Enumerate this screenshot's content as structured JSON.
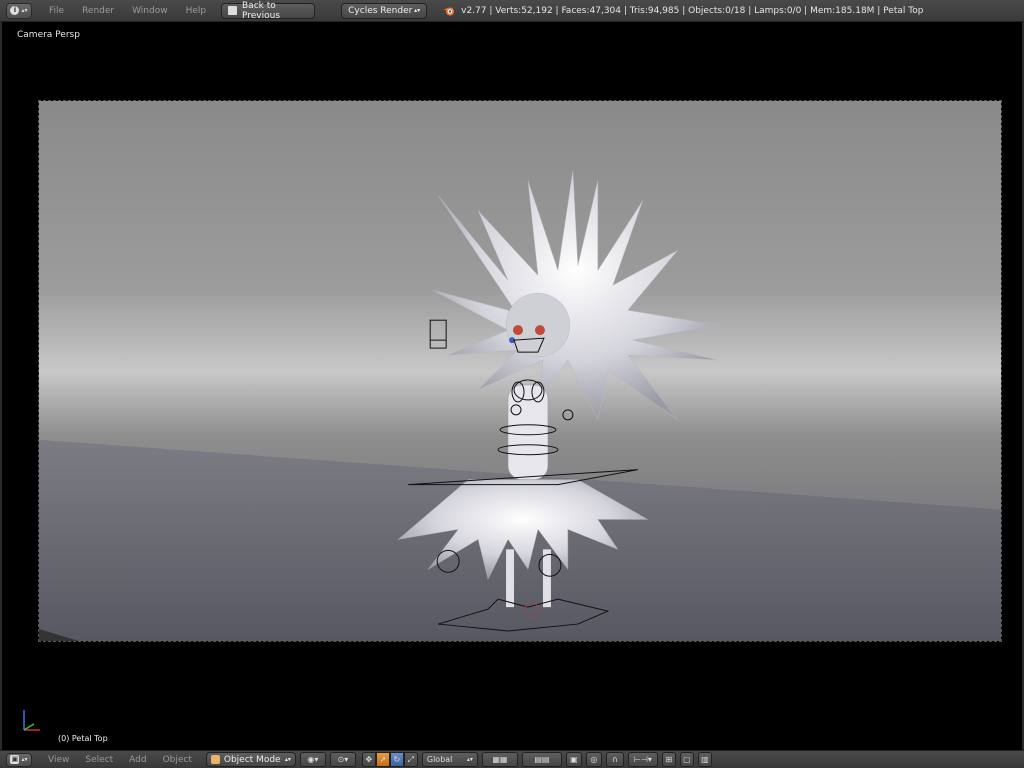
{
  "topbar": {
    "editor_icon": "info-icon",
    "menus": [
      "File",
      "Render",
      "Window",
      "Help"
    ],
    "back_button": "Back to Previous",
    "render_engine": "Cycles Render",
    "stats": "v2.77 | Verts:52,192 | Faces:47,304 | Tris:94,985 | Objects:0/18 | Lamps:0/0 | Mem:185.18M | Petal Top"
  },
  "viewport": {
    "view_name": "Camera Persp",
    "active_object": "(0) Petal Top"
  },
  "bottombar": {
    "editor_icon": "3d-view-icon",
    "menus": [
      "View",
      "Select",
      "Add",
      "Object"
    ],
    "mode": "Object Mode",
    "orientation": "Global"
  },
  "colors": {
    "header": "#444444",
    "background": "#000000",
    "accent_orange": "#e89a40",
    "accent_blue": "#5a7fc0"
  }
}
